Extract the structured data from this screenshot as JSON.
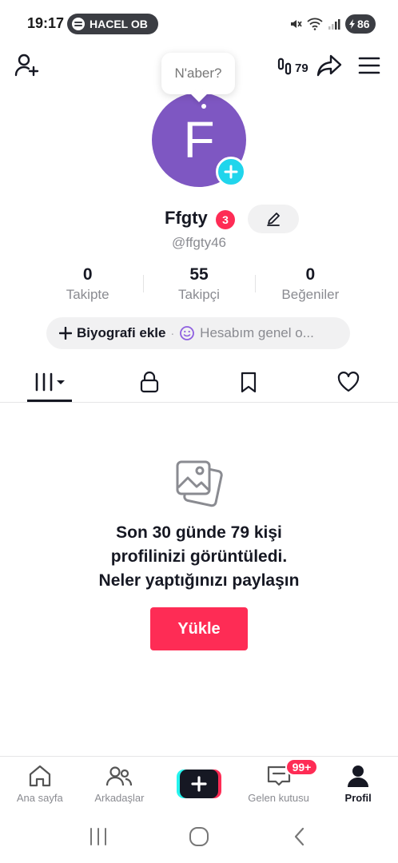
{
  "status_bar": {
    "time": "19:17",
    "media_pill": "HACEL OB",
    "battery": "86",
    "icons": [
      "mute-icon",
      "wifi-icon",
      "signal-icon",
      "battery-icon"
    ]
  },
  "header": {
    "icons": [
      "add-friend-icon",
      "profile-visitors-icon",
      "share-icon",
      "menu-icon"
    ],
    "visitors_count": "79"
  },
  "profile": {
    "status_bubble": "N'aber?",
    "avatar_letter": "F",
    "avatar_color": "#7e57c2",
    "name": "Ffgty",
    "badge_count": "3",
    "handle": "@ffgty46"
  },
  "stats": [
    {
      "value": "0",
      "label": "Takipte"
    },
    {
      "value": "55",
      "label": "Takipçi"
    },
    {
      "value": "0",
      "label": "Beğeniler"
    }
  ],
  "bio": {
    "add_label": "Biyografi ekle",
    "separator": "·",
    "hint": "Hesabım genel o..."
  },
  "tabs": [
    {
      "name": "videos",
      "icon": "grid-icon",
      "active": true
    },
    {
      "name": "private",
      "icon": "lock-icon",
      "active": false
    },
    {
      "name": "saved",
      "icon": "bookmark-icon",
      "active": false
    },
    {
      "name": "liked",
      "icon": "heart-icon",
      "active": false
    }
  ],
  "empty_state": {
    "icon": "gallery-icon",
    "line1": "Son 30 günde 79 kişi",
    "line2": "profilinizi görüntüledi.",
    "line3": "Neler yaptığınızı paylaşın",
    "upload_label": "Yükle"
  },
  "bottom_nav": {
    "home": "Ana sayfa",
    "friends": "Arkadaşlar",
    "inbox": "Gelen kutusu",
    "inbox_badge": "99+",
    "profile": "Profil"
  },
  "colors": {
    "accent": "#fe2c55",
    "cyan": "#20d5ec",
    "text": "#161823",
    "muted": "#8a8b91"
  }
}
